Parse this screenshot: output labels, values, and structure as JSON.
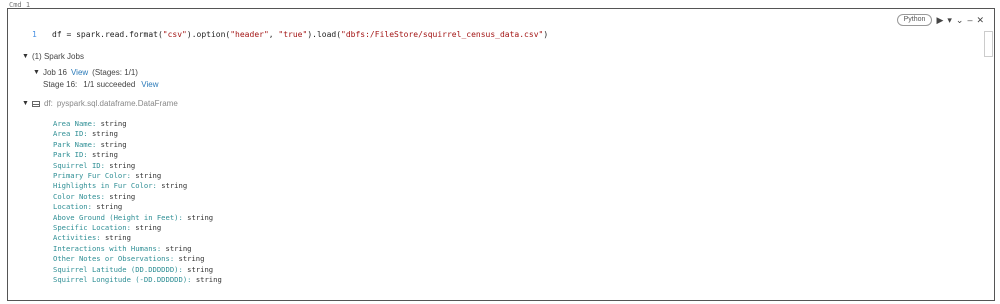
{
  "cell_label": "Cmd 1",
  "toolbar": {
    "language": "Python",
    "run_icon": "play-icon",
    "menu_icon": "chevron-down-icon",
    "minimize_icon": "minus-icon",
    "close_icon": "close-icon"
  },
  "code": {
    "line_number": "1",
    "prefix": "df = spark.read.format(",
    "arg1": "\"csv\"",
    "mid1": ").option(",
    "arg2": "\"header\"",
    "mid2": ", ",
    "arg3": "\"true\"",
    "mid3": ").load(",
    "arg4": "\"dbfs:/FileStore/squirrel_census_data.csv\"",
    "suffix": ")"
  },
  "spark_jobs": {
    "summary": "(1) Spark Jobs",
    "job": {
      "label": "Job 16",
      "view": "View",
      "stages": "(Stages: 1/1)"
    },
    "stage": {
      "label": "Stage 16:",
      "status": "1/1 succeeded",
      "view": "View"
    }
  },
  "dataframe": {
    "name": "df:",
    "type": "pyspark.sql.dataframe.DataFrame",
    "fields": [
      {
        "name": "Area Name:",
        "type": "string"
      },
      {
        "name": "Area ID:",
        "type": "string"
      },
      {
        "name": "Park Name:",
        "type": "string"
      },
      {
        "name": "Park ID:",
        "type": "string"
      },
      {
        "name": "Squirrel ID:",
        "type": "string"
      },
      {
        "name": "Primary Fur Color:",
        "type": "string"
      },
      {
        "name": "Highlights in Fur Color:",
        "type": "string"
      },
      {
        "name": "Color Notes:",
        "type": "string"
      },
      {
        "name": "Location:",
        "type": "string"
      },
      {
        "name": "Above Ground (Height in Feet):",
        "type": "string"
      },
      {
        "name": "Specific Location:",
        "type": "string"
      },
      {
        "name": "Activities:",
        "type": "string"
      },
      {
        "name": "Interactions with Humans:",
        "type": "string"
      },
      {
        "name": "Other Notes or Observations:",
        "type": "string"
      },
      {
        "name": "Squirrel Latitude (DD.DDDDDD):",
        "type": "string"
      },
      {
        "name": "Squirrel Longitude (-DD.DDDDDD):",
        "type": "string"
      }
    ]
  }
}
